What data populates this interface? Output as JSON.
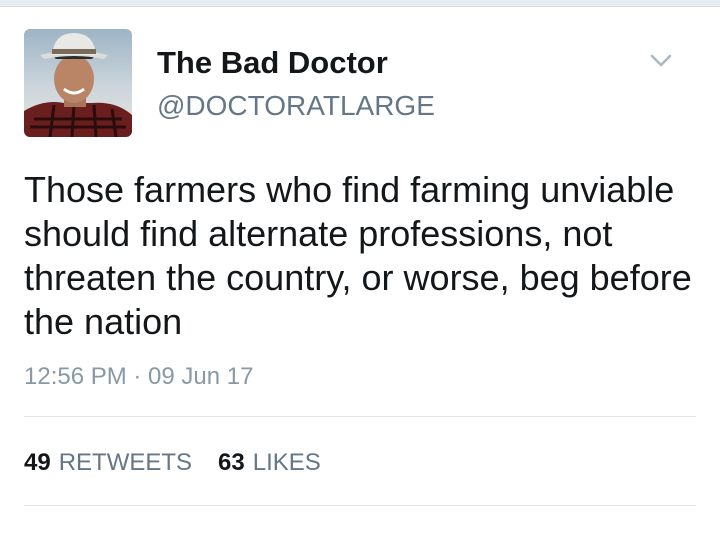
{
  "user": {
    "display_name": "The Bad Doctor",
    "handle": "@DOCTORATLARGE",
    "avatar_icon": "profile-photo-man-in-hat"
  },
  "tweet": {
    "text": "Those farmers who find farming unviable should find alternate professions, not threaten the country, or worse, beg before the nation",
    "timestamp": "12:56 PM · 09 Jun 17"
  },
  "stats": {
    "retweets_count": "49",
    "retweets_label": "RETWEETS",
    "likes_count": "63",
    "likes_label": "LIKES"
  },
  "menu": {
    "icon": "chevron-down-icon"
  },
  "colors": {
    "primary_text": "#14171a",
    "secondary_text": "#657786",
    "timestamp_text": "#8899a6",
    "divider": "#e1e8ed",
    "caret": "#aab8c2"
  }
}
